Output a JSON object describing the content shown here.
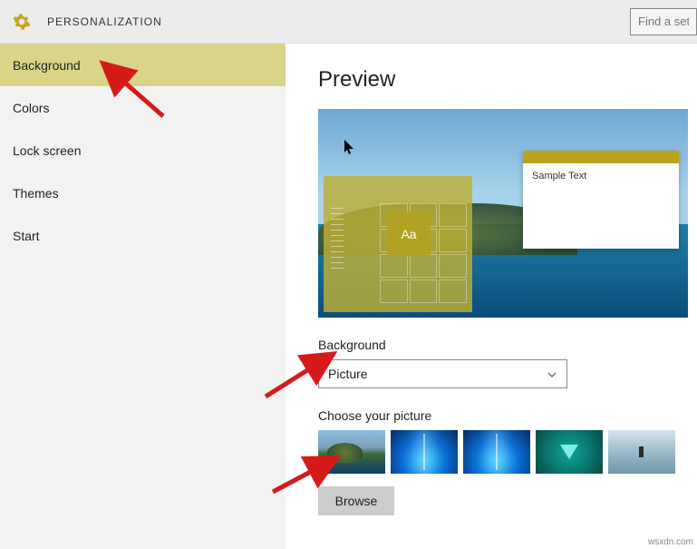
{
  "header": {
    "title": "PERSONALIZATION",
    "search_placeholder": "Find a set"
  },
  "sidebar": {
    "items": [
      {
        "label": "Background",
        "selected": true
      },
      {
        "label": "Colors",
        "selected": false
      },
      {
        "label": "Lock screen",
        "selected": false
      },
      {
        "label": "Themes",
        "selected": false
      },
      {
        "label": "Start",
        "selected": false
      }
    ]
  },
  "content": {
    "preview_title": "Preview",
    "sample_text": "Sample Text",
    "aa_label": "Aa",
    "background_label": "Background",
    "background_dropdown": {
      "selected": "Picture"
    },
    "choose_picture_label": "Choose your picture",
    "thumbnails": [
      {
        "name": "hawaii-crater"
      },
      {
        "name": "windows-hero-1"
      },
      {
        "name": "windows-hero-2"
      },
      {
        "name": "teal-triangle"
      },
      {
        "name": "beach-person"
      }
    ],
    "browse_label": "Browse"
  },
  "annotations": {
    "arrow_color": "#d61a1a"
  },
  "watermark": "wsxdn.com"
}
